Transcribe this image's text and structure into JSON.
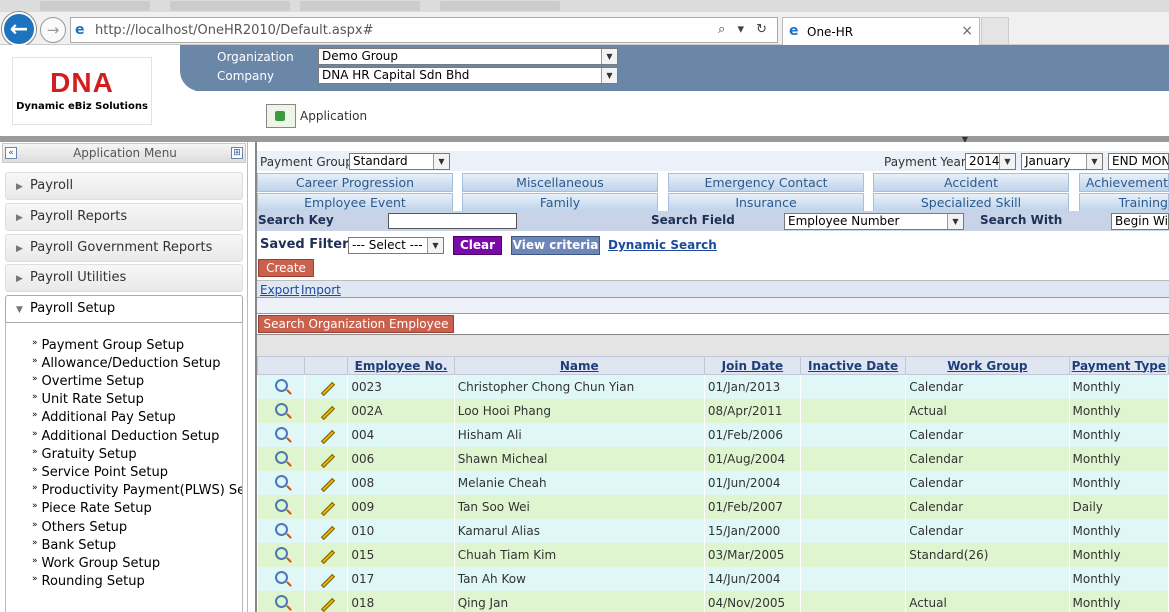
{
  "browser": {
    "url": "http://localhost/OneHR2010/Default.aspx#",
    "tab_title": "One-HR",
    "back_symbol": "←",
    "forward_symbol": "→",
    "ie_symbol": "e",
    "close_symbol": "×",
    "controls": "⌕ ▾ ↻"
  },
  "header": {
    "logo_text": "DNA",
    "logo_sub": "Dynamic eBiz Solutions",
    "organization_label": "Organization",
    "organization_value": "Demo Group",
    "company_label": "Company",
    "company_value": "DNA HR Capital Sdn Bhd",
    "application_label": "Application"
  },
  "sidebar": {
    "title": "Application Menu",
    "collapse_symbol": "«",
    "pin_symbol": "⊞",
    "sections": [
      {
        "label": "Payroll"
      },
      {
        "label": "Payroll Reports"
      },
      {
        "label": "Payroll Government Reports"
      },
      {
        "label": "Payroll Utilities"
      },
      {
        "label": "Payroll Setup"
      }
    ],
    "setup_items": [
      "Payment Group Setup",
      "Allowance/Deduction Setup",
      "Overtime Setup",
      "Unit Rate Setup",
      "Additional Pay Setup",
      "Additional Deduction Setup",
      "Gratuity Setup",
      "Service Point Setup",
      "Productivity Payment(PLWS) Setup",
      "Piece Rate Setup",
      "Others Setup",
      "Bank Setup",
      "Work Group Setup",
      "Rounding Setup"
    ]
  },
  "filters": {
    "payment_group_label": "Payment Group",
    "payment_group_value": "Standard",
    "payment_year_label": "Payment Year",
    "payment_year_value": "2014",
    "month_value": "January",
    "period_value": "END MONTH"
  },
  "tabs_row1": [
    "Career Progression",
    "Miscellaneous",
    "Emergency Contact",
    "Accident",
    "Achievement"
  ],
  "tabs_row2": [
    "Employee Event",
    "Family",
    "Insurance",
    "Specialized Skill",
    "Training"
  ],
  "search": {
    "key_label": "Search Key",
    "key_value": "",
    "field_label": "Search Field",
    "field_value": "Employee Number",
    "with_label": "Search With",
    "with_value": "Begin With"
  },
  "saved_filter": {
    "label": "Saved Filter",
    "select_value": "--- Select ---",
    "clear_label": "Clear",
    "view_label": "View criteria",
    "dynamic_label": "Dynamic Search"
  },
  "actions": {
    "create_label": "Create",
    "export_label": "Export",
    "import_label": "Import",
    "search_org_label": "Search Organization Employee"
  },
  "table": {
    "columns": [
      "Employee No.",
      "Name",
      "Join Date",
      "Inactive Date",
      "Work Group",
      "Payment Type"
    ],
    "rows": [
      {
        "no": "0023",
        "name": "Christopher Chong Chun Yian",
        "join": "01/Jan/2013",
        "inactive": "",
        "group": "Calendar",
        "pay": "Monthly"
      },
      {
        "no": "002A",
        "name": "Loo Hooi Phang",
        "join": "08/Apr/2011",
        "inactive": "",
        "group": "Actual",
        "pay": "Monthly"
      },
      {
        "no": "004",
        "name": "Hisham Ali",
        "join": "01/Feb/2006",
        "inactive": "",
        "group": "Calendar",
        "pay": "Monthly"
      },
      {
        "no": "006",
        "name": "Shawn Micheal",
        "join": "01/Aug/2004",
        "inactive": "",
        "group": "Calendar",
        "pay": "Monthly"
      },
      {
        "no": "008",
        "name": "Melanie Cheah",
        "join": "01/Jun/2004",
        "inactive": "",
        "group": "Calendar",
        "pay": "Monthly"
      },
      {
        "no": "009",
        "name": "Tan Soo Wei",
        "join": "01/Feb/2007",
        "inactive": "",
        "group": "Calendar",
        "pay": "Daily"
      },
      {
        "no": "010",
        "name": "Kamarul Alias",
        "join": "15/Jan/2000",
        "inactive": "",
        "group": "Calendar",
        "pay": "Monthly"
      },
      {
        "no": "015",
        "name": "Chuah Tiam Kim",
        "join": "03/Mar/2005",
        "inactive": "",
        "group": "Standard(26)",
        "pay": "Monthly"
      },
      {
        "no": "017",
        "name": "Tan Ah Kow",
        "join": "14/Jun/2004",
        "inactive": "",
        "group": "",
        "pay": "Monthly"
      },
      {
        "no": "018",
        "name": "Qing Jan",
        "join": "04/Nov/2005",
        "inactive": "",
        "group": "Actual",
        "pay": "Monthly"
      }
    ]
  },
  "colors": {
    "header_band": "#6a87a8",
    "row_odd": "#dff7f7",
    "row_even": "#dff5d0",
    "clear_button": "#7a0aa8",
    "view_button": "#6f86b8",
    "create_button": "#c8614e"
  }
}
